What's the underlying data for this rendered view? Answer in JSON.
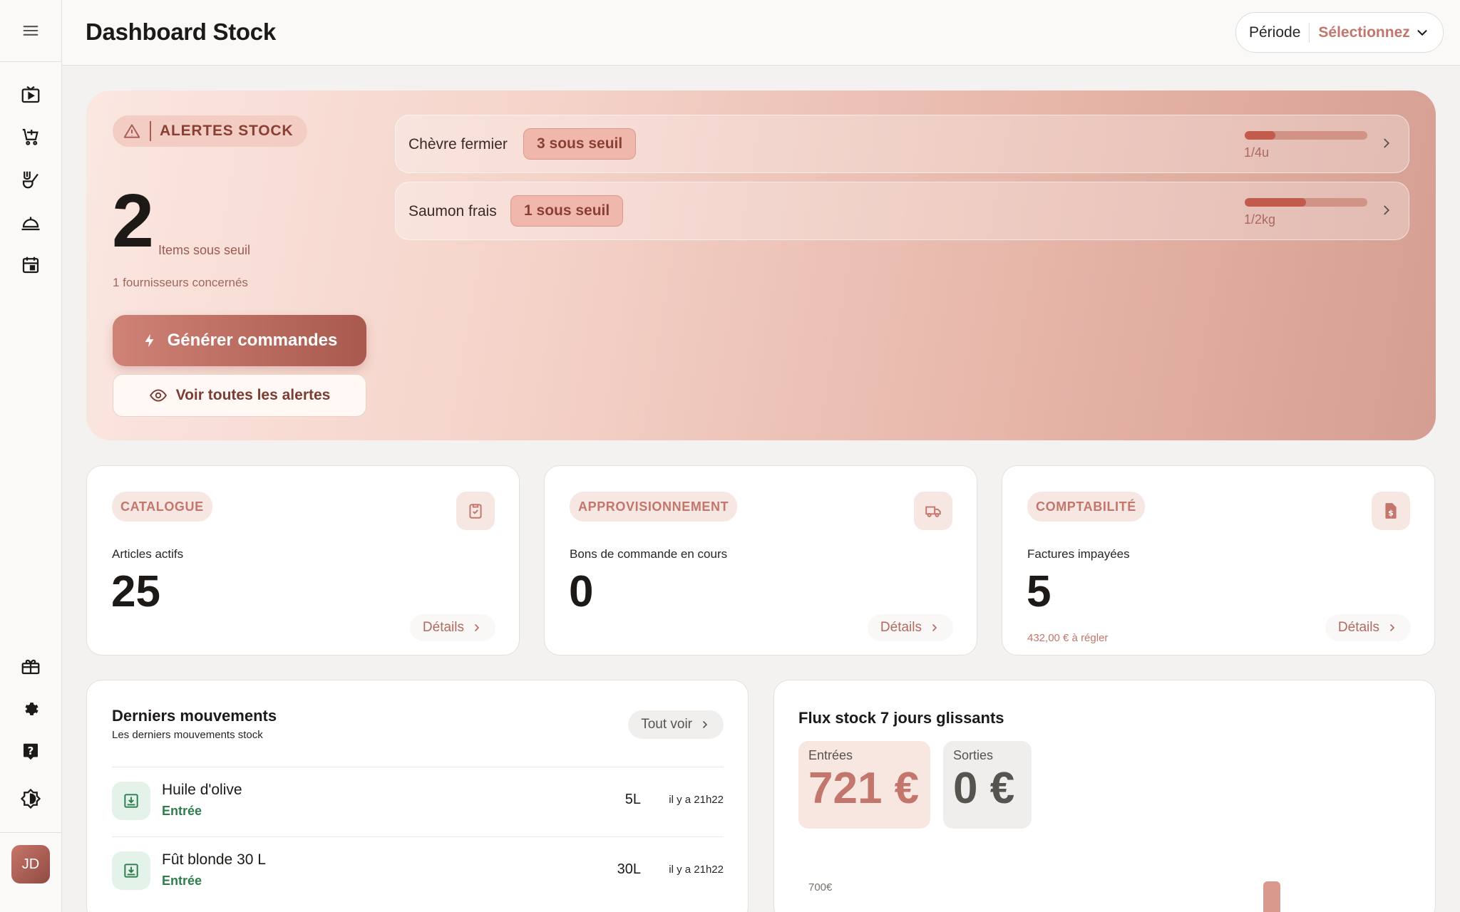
{
  "header": {
    "title": "Dashboard Stock",
    "period_label": "Période",
    "period_value": "Sélectionnez"
  },
  "sidebar": {
    "items": [
      "menu-icon",
      "tv-play-icon",
      "cart-add-icon",
      "chef-icon",
      "cloche-icon",
      "calendar-icon",
      "gift-icon",
      "gear-icon",
      "help-icon",
      "theme-icon"
    ],
    "avatar_initials": "JD"
  },
  "alerts": {
    "badge": "ALERTES STOCK",
    "count": "2",
    "count_label": "Items sous seuil",
    "suppliers": "1 fournisseurs concernés",
    "generate_btn": "Générer commandes",
    "view_all_btn": "Voir toutes les alertes",
    "items": [
      {
        "name": "Chèvre fermier",
        "chip": "3 sous seuil",
        "qty": "1/4u",
        "level": 0.25
      },
      {
        "name": "Saumon frais",
        "chip": "1 sous seuil",
        "qty": "1/2kg",
        "level": 0.5
      }
    ]
  },
  "kpis": [
    {
      "tag": "CATALOGUE",
      "label": "Articles actifs",
      "value": "25",
      "sub": "",
      "btn": "Détails",
      "icon": "clipboard-check-icon"
    },
    {
      "tag": "APPROVISIONNEMENT",
      "label": "Bons de commande en cours",
      "value": "0",
      "sub": "",
      "btn": "Détails",
      "icon": "truck-icon"
    },
    {
      "tag": "COMPTABILITÉ",
      "label": "Factures impayées",
      "value": "5",
      "sub": "432,00 € à régler",
      "btn": "Détails",
      "icon": "invoice-dollar-icon"
    }
  ],
  "movements": {
    "title": "Derniers mouvements",
    "subtitle": "Les derniers mouvements stock",
    "all_btn": "Tout voir",
    "rows": [
      {
        "name": "Huile d'olive",
        "type": "Entrée",
        "qty": "5L",
        "time": "il y a 21h22"
      },
      {
        "name": "Fût blonde 30 L",
        "type": "Entrée",
        "qty": "30L",
        "time": "il y a 21h22"
      }
    ]
  },
  "flux": {
    "title": "Flux stock 7 jours glissants",
    "in_label": "Entrées",
    "in_value": "721 €",
    "out_label": "Sorties",
    "out_value": "0 €",
    "axis_top": "700€"
  },
  "colors": {
    "accent": "#c2766c",
    "accent_dark": "#8a3f34",
    "success": "#2f7d4f"
  }
}
